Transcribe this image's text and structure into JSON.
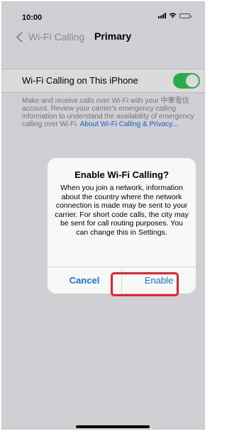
{
  "status": {
    "time": "10:00",
    "icons": [
      "cellular-signal-icon",
      "wifi-icon",
      "battery-icon"
    ]
  },
  "nav": {
    "back_label": "Wi-Fi Calling",
    "title": "Primary"
  },
  "settings": {
    "wifi_calling_label": "Wi-Fi Calling on This iPhone",
    "wifi_calling_on": true,
    "footnote_text": "Make and receive calls over Wi-Fi with your 中華電信 account. Review your carrier's emergency calling information to understand the availability of emergency calling over Wi-Fi. ",
    "footnote_link": "About Wi-Fi Calling & Privacy..."
  },
  "alert": {
    "title": "Enable Wi-Fi Calling?",
    "message": "When you join a network, information about the country where the network connection is made may be sent to your carrier. For short code calls, the city may be sent for call routing purposes. You can change this in Settings.",
    "cancel_label": "Cancel",
    "enable_label": "Enable"
  },
  "colors": {
    "accent": "#1a73e8",
    "toggle_on": "#34c759",
    "highlight": "#e8232a"
  }
}
